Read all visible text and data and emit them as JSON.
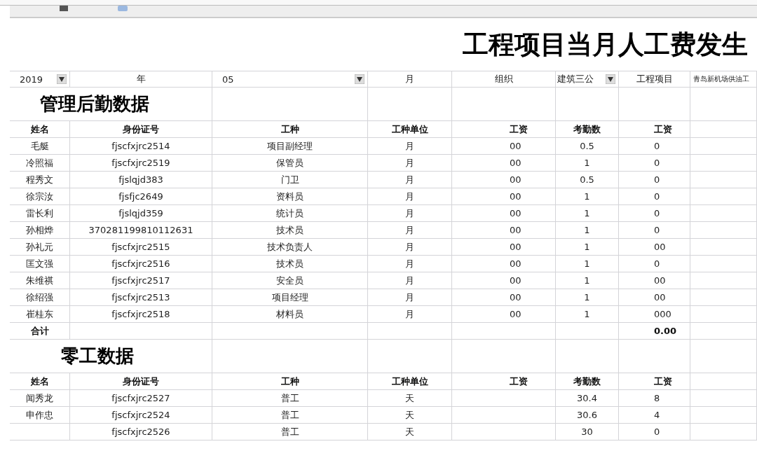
{
  "title": "工程项目当月人工费发生",
  "filters": [
    {
      "kind": "dropdown",
      "value": "2019"
    },
    {
      "kind": "label",
      "value": "年"
    },
    {
      "kind": "dropdown",
      "value": "05"
    },
    {
      "kind": "label",
      "value": "月"
    },
    {
      "kind": "label",
      "value": "组织"
    },
    {
      "kind": "dropdown",
      "value": "建筑三公"
    },
    {
      "kind": "label",
      "value": "工程项目"
    },
    {
      "kind": "small",
      "value": "青岛新机场供油工"
    }
  ],
  "sections": [
    {
      "heading": "管理后勤数据",
      "columns": [
        "姓名",
        "身份证号",
        "工种",
        "工种单位",
        "工资",
        "考勤数",
        "工资"
      ],
      "rows": [
        {
          "name": "毛艇",
          "id": "fjscfxjrc2514",
          "trade": "项目副经理",
          "unit": "月",
          "unit_wage": "00",
          "attendance": "0.5",
          "pay": "0"
        },
        {
          "name": "冷照福",
          "id": "fjscfxjrc2519",
          "trade": "保管员",
          "unit": "月",
          "unit_wage": "00",
          "attendance": "1",
          "pay": "0"
        },
        {
          "name": "程秀文",
          "id": "fjslqjd383",
          "trade": "门卫",
          "unit": "月",
          "unit_wage": "00",
          "attendance": "0.5",
          "pay": "0"
        },
        {
          "name": "徐宗汝",
          "id": "fjsfjc2649",
          "trade": "资料员",
          "unit": "月",
          "unit_wage": "00",
          "attendance": "1",
          "pay": "0"
        },
        {
          "name": "雷长利",
          "id": "fjslqjd359",
          "trade": "统计员",
          "unit": "月",
          "unit_wage": "00",
          "attendance": "1",
          "pay": "0"
        },
        {
          "name": "孙相烨",
          "id": "370281199810112631",
          "trade": "技术员",
          "unit": "月",
          "unit_wage": "00",
          "attendance": "1",
          "pay": "0"
        },
        {
          "name": "孙礼元",
          "id": "fjscfxjrc2515",
          "trade": "技术负责人",
          "unit": "月",
          "unit_wage": "00",
          "attendance": "1",
          "pay": "00"
        },
        {
          "name": "匡文强",
          "id": "fjscfxjrc2516",
          "trade": "技术员",
          "unit": "月",
          "unit_wage": "00",
          "attendance": "1",
          "pay": "0"
        },
        {
          "name": "朱维祺",
          "id": "fjscfxjrc2517",
          "trade": "安全员",
          "unit": "月",
          "unit_wage": "00",
          "attendance": "1",
          "pay": "00"
        },
        {
          "name": "徐绍强",
          "id": "fjscfxjrc2513",
          "trade": "项目经理",
          "unit": "月",
          "unit_wage": "00",
          "attendance": "1",
          "pay": "00"
        },
        {
          "name": "崔桂东",
          "id": "fjscfxjrc2518",
          "trade": "材料员",
          "unit": "月",
          "unit_wage": "00",
          "attendance": "1",
          "pay": "000"
        }
      ],
      "total": {
        "label": "合计",
        "value": "0.00"
      }
    },
    {
      "heading": "零工数据",
      "columns": [
        "姓名",
        "身份证号",
        "工种",
        "工种单位",
        "工资",
        "考勤数",
        "工资"
      ],
      "rows": [
        {
          "name": "闻秀龙",
          "id": "fjscfxjrc2527",
          "trade": "普工",
          "unit": "天",
          "attendance": "30.4",
          "pay": "8"
        },
        {
          "name": "申作忠",
          "id": "fjscfxjrc2524",
          "trade": "普工",
          "unit": "天",
          "attendance": "30.6",
          "pay": "4"
        },
        {
          "id": "fjscfxjrc2526",
          "trade": "普工",
          "unit": "天",
          "attendance": "30",
          "pay": "0"
        }
      ]
    }
  ]
}
